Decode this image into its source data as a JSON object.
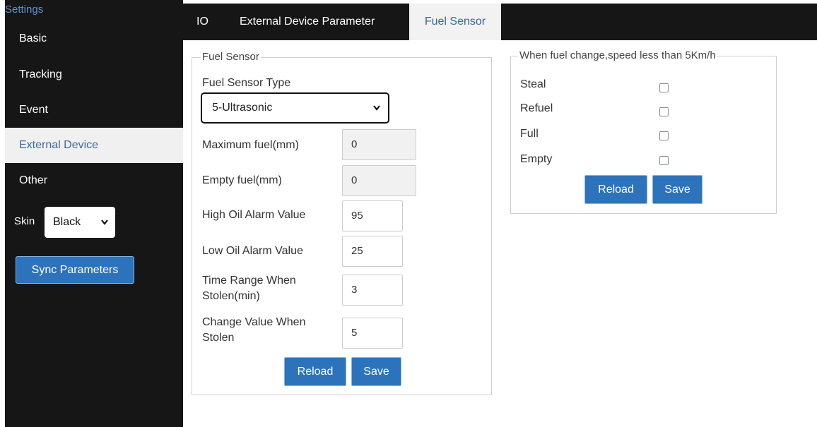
{
  "sidebar": {
    "title": "Settings",
    "items": [
      {
        "label": "Basic",
        "active": false
      },
      {
        "label": "Tracking",
        "active": false
      },
      {
        "label": "Event",
        "active": false
      },
      {
        "label": "External Device",
        "active": true
      },
      {
        "label": "Other",
        "active": false
      }
    ],
    "skin_label": "Skin",
    "skin_value": "Black",
    "sync_button": "Sync Parameters"
  },
  "tabs": [
    {
      "label": "IO",
      "active": false
    },
    {
      "label": "External Device Parameter",
      "active": false
    },
    {
      "label": "Fuel Sensor",
      "active": true
    }
  ],
  "fuel_sensor": {
    "legend": "Fuel Sensor",
    "type_label": "Fuel Sensor Type",
    "type_value": "5-Ultrasonic",
    "fields": [
      {
        "label": "Maximum fuel(mm)",
        "value": "0",
        "readonly": true
      },
      {
        "label": "Empty fuel(mm)",
        "value": "0",
        "readonly": true
      },
      {
        "label": "High Oil Alarm Value",
        "value": "95",
        "readonly": false
      },
      {
        "label": "Low Oil Alarm Value",
        "value": "25",
        "readonly": false
      },
      {
        "label_line1": "Time Range When",
        "label_line2": "Stolen(min)",
        "value": "3",
        "readonly": false
      },
      {
        "label_line1": "Change Value When",
        "label_line2": "Stolen",
        "value": "5",
        "readonly": false
      }
    ],
    "reload_label": "Reload",
    "save_label": "Save"
  },
  "fuel_change": {
    "legend": "When fuel change,speed less than 5Km/h",
    "options": [
      {
        "label": "Steal",
        "checked": false
      },
      {
        "label": "Refuel",
        "checked": false
      },
      {
        "label": "Full",
        "checked": false
      },
      {
        "label": "Empty",
        "checked": false
      }
    ],
    "reload_label": "Reload",
    "save_label": "Save"
  },
  "colors": {
    "sidebar_bg": "#161616",
    "accent_button": "#2d73bb",
    "active_tab_text": "#2e6aa6",
    "title_blue": "#5b93d4"
  }
}
